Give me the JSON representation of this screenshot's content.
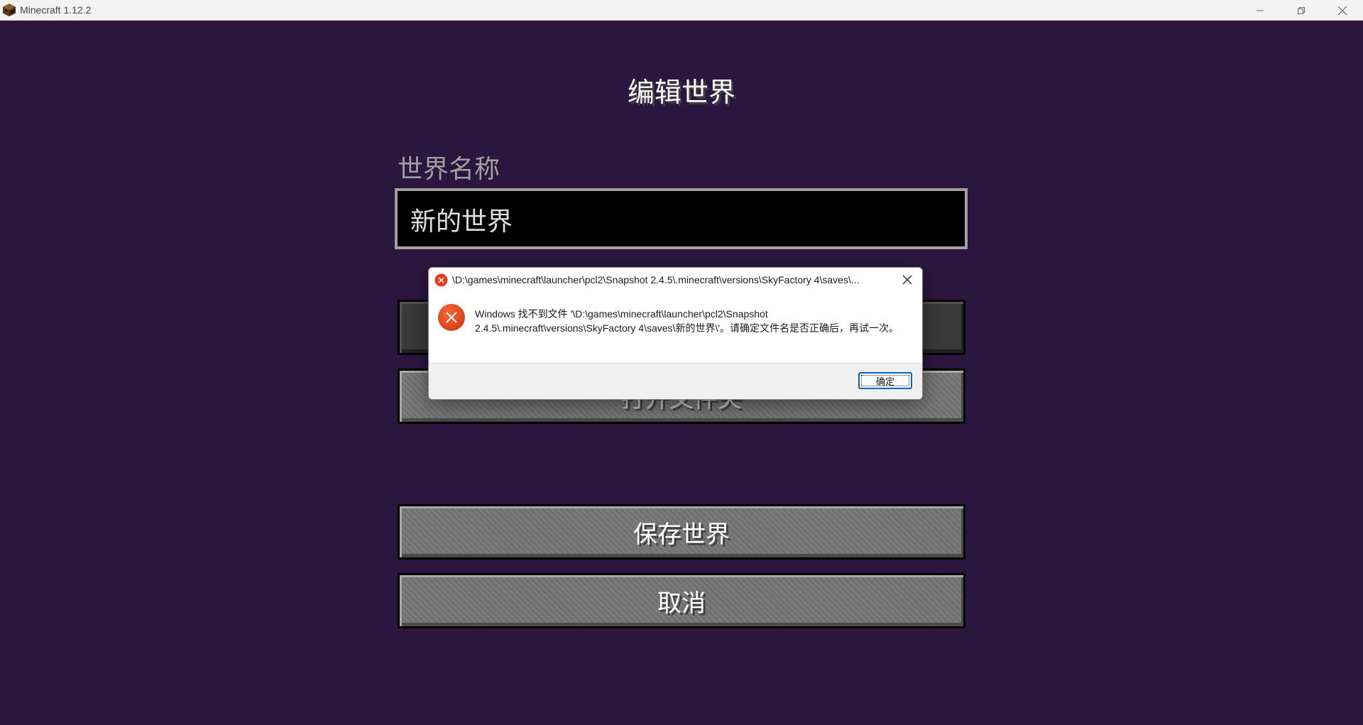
{
  "window": {
    "title": "Minecraft 1.12.2",
    "icon": "minecraft-block-icon"
  },
  "screen": {
    "title": "编辑世界",
    "world_name_label": "世界名称",
    "world_name_value": "新的世界",
    "buttons": {
      "open_folder": "打开文件夹",
      "save": "保存世界",
      "cancel": "取消"
    }
  },
  "dialog": {
    "title": "\\D:\\games\\minecraft\\launcher\\pcl2\\Snapshot 2.4.5\\.minecraft\\versions\\SkyFactory 4\\saves\\...",
    "message": "Windows 找不到文件 '\\D:\\games\\minecraft\\launcher\\pcl2\\Snapshot 2.4.5\\.minecraft\\versions\\SkyFactory 4\\saves\\新的世界\\'。请确定文件名是否正确后，再试一次。",
    "ok_label": "确定",
    "icon": "error-icon"
  },
  "colors": {
    "background": "#2b1640",
    "error_red": "#e0401c",
    "accent_blue": "#0067c0"
  }
}
